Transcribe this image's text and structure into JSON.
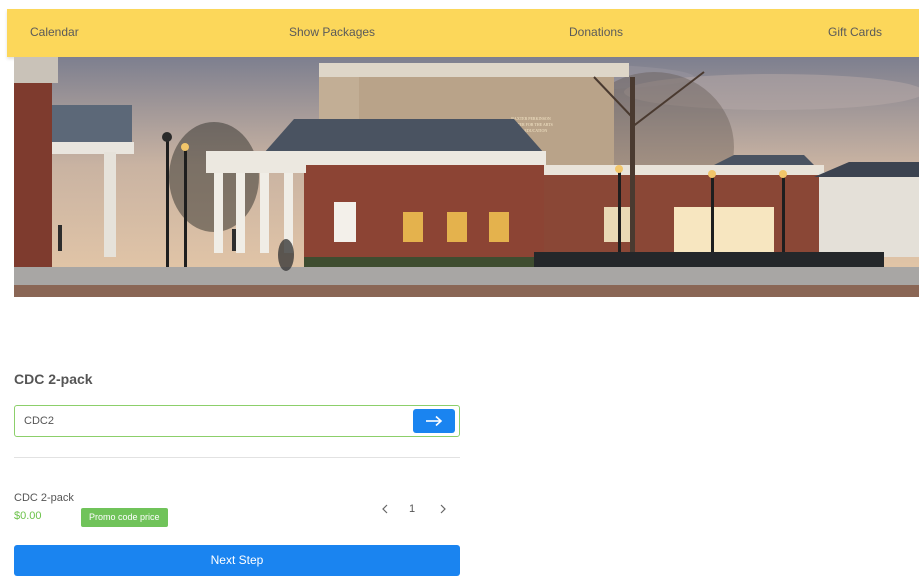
{
  "nav": {
    "items": [
      "Calendar",
      "Show Packages",
      "Donations",
      "Gift Cards"
    ]
  },
  "hero": {
    "sign_lines": [
      "BAXTER PERKINSON",
      "CENTER FOR THE ARTS",
      "AND EDUCATION"
    ]
  },
  "package": {
    "title": "CDC 2-pack",
    "promo_code_value": "CDC2"
  },
  "item": {
    "name": "CDC 2-pack",
    "price": "$0.00",
    "badge": "Promo code price",
    "quantity": "1"
  },
  "actions": {
    "next_label": "Next Step"
  },
  "colors": {
    "nav_bg": "#fcd75a",
    "accent_blue": "#1a84f0",
    "promo_green": "#70c35a",
    "price_green": "#6cc24a"
  },
  "icons": {
    "promo_submit": "arrow-right-icon",
    "qty_prev": "chevron-left-icon",
    "qty_next": "chevron-right-icon"
  }
}
